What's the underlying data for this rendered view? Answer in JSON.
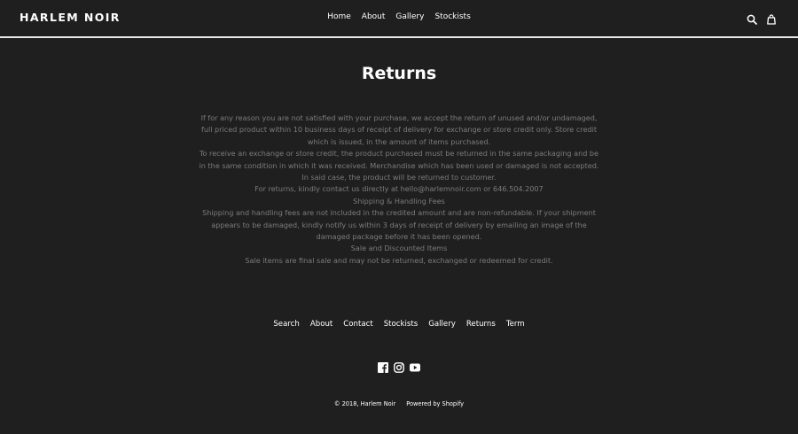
{
  "header": {
    "logo": "HARLEM NOIR",
    "nav": [
      "Home",
      "About",
      "Gallery",
      "Stockists"
    ],
    "icons": [
      "search-icon",
      "cart-icon"
    ]
  },
  "main": {
    "title": "Returns",
    "paragraphs": [
      "If for any reason you are not satisfied with your purchase, we accept the return of unused and/or undamaged, full priced product within 10 business days of receipt of delivery for exchange or store credit only.  Store credit which is issued, in the amount of items purchased.",
      "To receive an exchange or store credit, the product purchased must be returned in the same packaging and be in the same condition in which it was received. Merchandise which has been used or damaged is not accepted.  In said case, the product will be returned to customer.",
      "For returns, kindly contact us directly at hello@harlemnoir.com or 646.504.2007",
      "Shipping & Handling Fees",
      "Shipping and handling fees are not included in the credited amount and are non-refundable. If your shipment appears to be damaged, kindly notify us within 3 days of receipt of delivery by emailing an image of the damaged package before it has been opened.",
      "Sale and Discounted Items",
      "Sale items are final sale and may not be returned, exchanged or redeemed for credit."
    ]
  },
  "footer": {
    "links": [
      "Search",
      "About",
      "Contact",
      "Stockists",
      "Gallery",
      "Returns",
      "Term"
    ],
    "social_icons": [
      "facebook-icon",
      "instagram-icon",
      "youtube-icon"
    ],
    "copyright": "© 2018, Harlem Noir",
    "powered_by": "Powered by Shopify"
  },
  "colors": {
    "background": "#1f1f1f",
    "text": "#ffffff",
    "body_text": "#7c7c7c",
    "header_rule": "#e8e8e8"
  }
}
